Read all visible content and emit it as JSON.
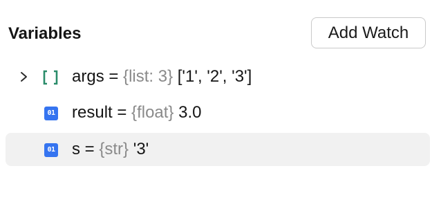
{
  "panel": {
    "title": "Variables",
    "add_watch_label": "Add Watch"
  },
  "variables": [
    {
      "name": "args",
      "equals": "=",
      "type": "{list: 3}",
      "value": "['1', '2', '3']",
      "icon": "list-icon",
      "expandable": true,
      "selected": false
    },
    {
      "name": "result",
      "equals": "=",
      "type": "{float}",
      "value": "3.0",
      "icon": "primitive-value-icon",
      "icon_text": "01",
      "expandable": false,
      "selected": false
    },
    {
      "name": "s",
      "equals": "=",
      "type": "{str}",
      "value": "'3'",
      "icon": "primitive-value-icon",
      "icon_text": "01",
      "expandable": false,
      "selected": true
    }
  ],
  "colors": {
    "list_icon": "#2a8c6a",
    "primitive_icon_bg": "#3574f0",
    "type_text": "#8a8a8a",
    "selected_row_bg": "#f1f1f1"
  }
}
